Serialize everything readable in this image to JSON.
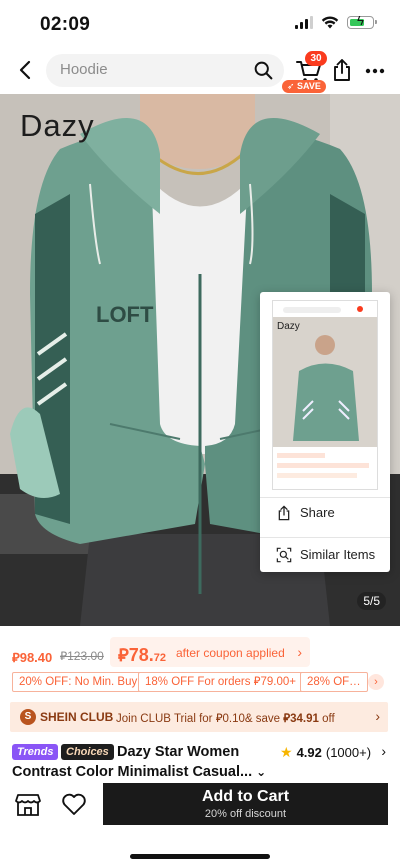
{
  "status_bar": {
    "time": "02:09"
  },
  "header": {
    "search_placeholder": "Hoodie",
    "cart_count": "30",
    "save_label": "SAVE"
  },
  "hero": {
    "brand": "Dazy",
    "image_counter": "5/5",
    "popup": {
      "share_label": "Share",
      "similar_label": "Similar Items",
      "thumb_brand": "Dazy"
    }
  },
  "price": {
    "sale": "⃁98.40",
    "original": "⃁123.00",
    "coupon_price_main": "⃁78.",
    "coupon_price_decimal": "72",
    "coupon_text": "after coupon applied"
  },
  "promos": [
    "20% OFF: No Min. Buy",
    "18% OFF For orders ⃁79.00+",
    "28% OF…"
  ],
  "club": {
    "title": "SHEIN CLUB",
    "text_prefix": "Join CLUB Trial for ⃁0.10& save ",
    "text_amount": "⃁34.91",
    "text_suffix": " off"
  },
  "product": {
    "tag_trends": "Trends",
    "tag_choices": "Choices",
    "title_line1": "Dazy Star Women",
    "title_line2": "Contrast Color Minimalist Casual...",
    "rating": "4.92",
    "rating_count": "(1000+)"
  },
  "bottom": {
    "add_to_cart": "Add to Cart",
    "discount": "20% off discount"
  },
  "colors": {
    "accent": "#fa6338",
    "hoodie_green": "#6fa08f",
    "dark": "#1a1a1a"
  }
}
